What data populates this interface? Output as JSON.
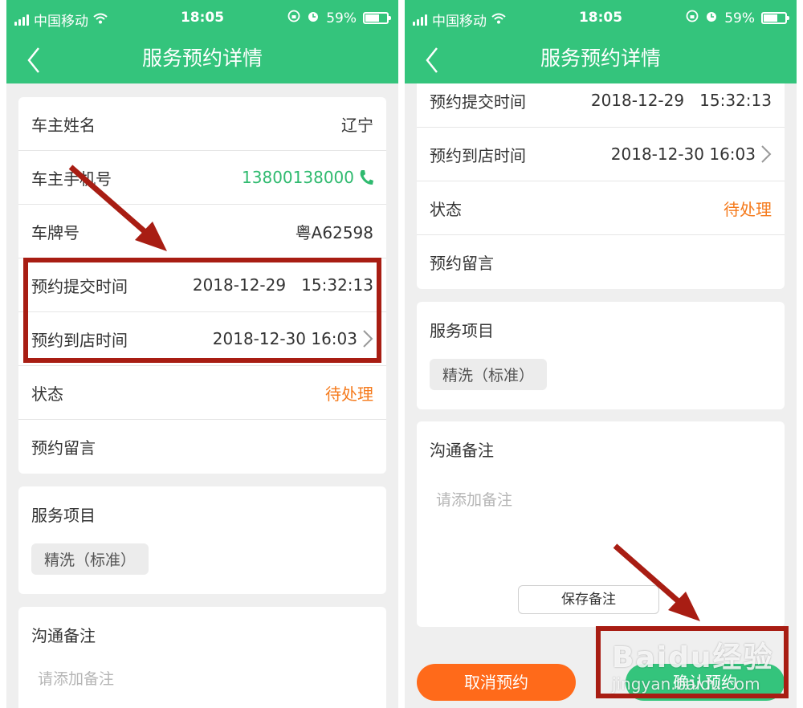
{
  "status_bar": {
    "carrier": "中国移动",
    "time": "18:05",
    "battery": "59%",
    "battery_level": 0.59
  },
  "nav": {
    "title": "服务预约详情"
  },
  "details": {
    "owner_name_label": "车主姓名",
    "owner_name": "辽宁",
    "phone_label": "车主手机号",
    "phone": "13800138000",
    "plate_label": "车牌号",
    "plate": "粤A62598",
    "submit_time_label": "预约提交时间",
    "submit_time": "2018-12-29   15:32:13",
    "arrival_time_label": "预约到店时间",
    "arrival_time": "2018-12-30 16:03",
    "status_label": "状态",
    "status": "待处理",
    "message_label": "预约留言"
  },
  "service": {
    "title": "服务项目",
    "item": "精洗（标准）"
  },
  "notes": {
    "title": "沟通备注",
    "placeholder": "请添加备注",
    "save_label": "保存备注"
  },
  "actions": {
    "cancel": "取消预约",
    "confirm": "确认预约"
  },
  "watermark": {
    "logo": "Baidu经验",
    "url": "jingyan.baidu.com"
  },
  "colors": {
    "primary": "#34c47c",
    "status": "#f57a1c",
    "cancel": "#ff6a1a",
    "annotation": "#a81d13"
  }
}
